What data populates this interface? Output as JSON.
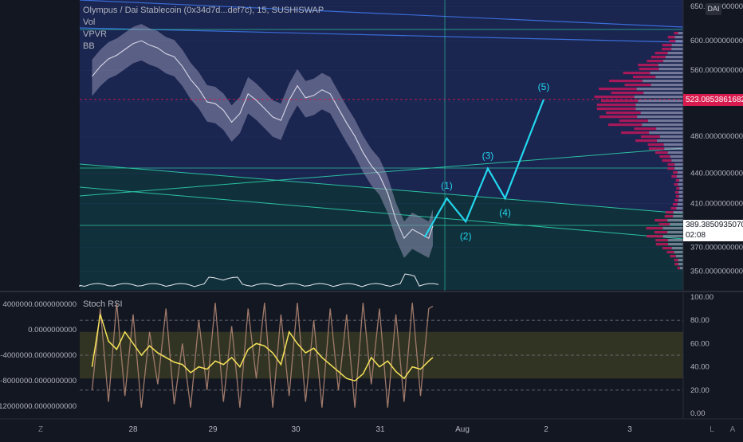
{
  "header": {
    "title": "Olympus / Dai Stablecoin (0x34d7d...def7c), 15, SUSHISWAP",
    "indicators": [
      "Vol",
      "VPVR",
      "BB"
    ],
    "currency_badge": "DAI"
  },
  "colors": {
    "background": "#131722",
    "wave": "#23d6ee",
    "price_tag": "#d81b4e",
    "stoch_k": "#f7e35a",
    "stoch_d": "#a07a6a",
    "band_fill": "#8f8fb0",
    "grid": "#2a2e39"
  },
  "chart_data": [
    {
      "type": "line",
      "title": "Olympus / Dai Stablecoin (0x34d7d...def7c), 15, SUSHISWAP",
      "x_ticks": [
        "28",
        "29",
        "30",
        "31",
        "Aug",
        "2",
        "3"
      ],
      "y_ticks": [
        "650.0000000000",
        "600.0000000000",
        "560.0000000000",
        "520.0000000000",
        "480.0000000000",
        "440.0000000000",
        "410.0000000000",
        "370.0000000000",
        "350.0000000000"
      ],
      "y_scale": "log",
      "ylim": [
        335,
        660
      ],
      "price_label": "523.0853861682",
      "last_price_label": "389.3850935070",
      "countdown_label": "02:08",
      "series": [
        {
          "name": "",
          "x": [
            27.5,
            27.6,
            27.7,
            27.8,
            27.9,
            28.0,
            28.1,
            28.2,
            28.3,
            28.4,
            28.5,
            28.6,
            28.7,
            28.8,
            28.9,
            29.0,
            29.1,
            29.2,
            29.3,
            29.4,
            29.5,
            29.6,
            29.7,
            29.8,
            29.9,
            30.0,
            30.1,
            30.2,
            30.3,
            30.4,
            30.5,
            30.6,
            30.7,
            30.8,
            30.9,
            31.0,
            31.1,
            31.2,
            31.3,
            31.4,
            31.5,
            31.6,
            31.65
          ],
          "y": [
            552,
            565,
            575,
            580,
            588,
            596,
            600,
            594,
            590,
            582,
            578,
            565,
            548,
            536,
            520,
            518,
            510,
            496,
            506,
            530,
            522,
            512,
            502,
            498,
            522,
            540,
            525,
            528,
            535,
            530,
            512,
            495,
            480,
            462,
            448,
            438,
            420,
            395,
            378,
            386,
            382,
            378,
            389
          ]
        }
      ],
      "wave_labels": [
        "(1)",
        "(2)",
        "(3)",
        "(4)",
        "(5)"
      ],
      "wave_points": [
        {
          "x": 31.55,
          "y": 379
        },
        {
          "x": 31.82,
          "y": 415
        },
        {
          "x": 32.05,
          "y": 393
        },
        {
          "x": 32.32,
          "y": 445
        },
        {
          "x": 32.53,
          "y": 415
        },
        {
          "x": 33.0,
          "y": 523
        }
      ]
    },
    {
      "type": "line",
      "title": "Stoch RSI",
      "y_ticks_left": [
        "4000000.0000000000",
        "0.0000000000",
        "-4000000.0000000000",
        "-8000000.0000000000",
        "-12000000.0000000000"
      ],
      "y_ticks_right": [
        "100.00",
        "80.00",
        "60.00",
        "40.00",
        "20.00",
        "0.00"
      ],
      "ylim": [
        -4,
        104
      ],
      "band_levels": [
        80,
        20
      ],
      "series": [
        {
          "name": "",
          "x": [
            27.5,
            27.6,
            27.7,
            27.8,
            27.9,
            28.0,
            28.1,
            28.2,
            28.3,
            28.4,
            28.5,
            28.6,
            28.7,
            28.8,
            28.9,
            29.0,
            29.1,
            29.2,
            29.3,
            29.4,
            29.5,
            29.6,
            29.7,
            29.8,
            29.9,
            30.0,
            30.1,
            30.2,
            30.3,
            30.4,
            30.5,
            30.6,
            30.7,
            30.8,
            30.9,
            31.0,
            31.1,
            31.2,
            31.3,
            31.4,
            31.5,
            31.6,
            31.65
          ],
          "y": [
            40,
            85,
            62,
            55,
            70,
            60,
            50,
            58,
            52,
            48,
            44,
            42,
            35,
            40,
            38,
            45,
            42,
            48,
            40,
            55,
            60,
            58,
            52,
            42,
            70,
            60,
            52,
            56,
            48,
            42,
            36,
            30,
            28,
            34,
            48,
            40,
            45,
            36,
            30,
            40,
            38,
            45,
            48
          ]
        },
        {
          "name": "",
          "x": [
            27.5,
            27.6,
            27.7,
            27.8,
            27.9,
            28.0,
            28.1,
            28.2,
            28.3,
            28.4,
            28.5,
            28.6,
            28.7,
            28.8,
            28.9,
            29.0,
            29.1,
            29.2,
            29.3,
            29.4,
            29.5,
            29.6,
            29.7,
            29.8,
            29.9,
            30.0,
            30.1,
            30.2,
            30.3,
            30.4,
            30.5,
            30.6,
            30.7,
            30.8,
            30.9,
            31.0,
            31.1,
            31.2,
            31.3,
            31.4,
            31.5,
            31.6,
            31.65
          ],
          "y": [
            20,
            90,
            10,
            95,
            15,
            85,
            5,
            70,
            25,
            90,
            8,
            60,
            5,
            80,
            20,
            95,
            10,
            75,
            5,
            90,
            30,
            95,
            5,
            85,
            15,
            95,
            10,
            80,
            5,
            90,
            20,
            85,
            5,
            95,
            25,
            90,
            5,
            85,
            10,
            95,
            15,
            90,
            92
          ]
        }
      ]
    }
  ]
}
